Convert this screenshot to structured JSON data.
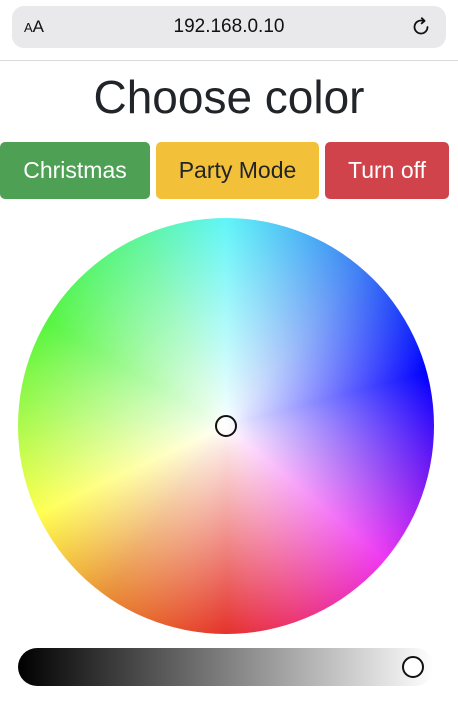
{
  "browser": {
    "text_size_label_small": "A",
    "text_size_label_large": "A",
    "url": "192.168.0.10",
    "reload_icon": "reload-icon"
  },
  "page": {
    "title": "Choose color"
  },
  "buttons": {
    "christmas": "Christmas",
    "party_mode": "Party Mode",
    "turn_off": "Turn off"
  },
  "colors": {
    "christmas": "#4ea154",
    "party_mode": "#f3c039",
    "turn_off": "#d0434a",
    "title_text": "#212529"
  },
  "color_picker": {
    "selected_hue_saturation": "center (white)",
    "brightness": 1.0
  }
}
